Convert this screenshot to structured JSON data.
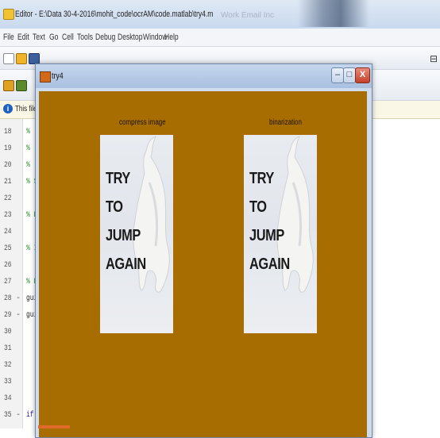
{
  "editor": {
    "title": "Editor - E:\\Data 30-4-2016\\mohit_code\\ocrAM\\code.matlab\\try4.m",
    "ghost_title": "Work Email Inc",
    "menu": [
      "File",
      "Edit",
      "Text",
      "Go",
      "Cell",
      "Tools",
      "Debug",
      "Desktop",
      "Window",
      "Help"
    ],
    "info_text": "This file uses C",
    "lines": [
      {
        "num": "18",
        "dash": "",
        "code": "%",
        "style": "comment"
      },
      {
        "num": "19",
        "dash": "",
        "code": "%",
        "style": "comment"
      },
      {
        "num": "20",
        "dash": "",
        "code": "%",
        "style": "comment"
      },
      {
        "num": "21",
        "dash": "",
        "code": "% S",
        "style": "comment"
      },
      {
        "num": "22",
        "dash": "",
        "code": "",
        "style": "comment"
      },
      {
        "num": "23",
        "dash": "",
        "code": "% E",
        "style": "comment"
      },
      {
        "num": "24",
        "dash": "",
        "code": "",
        "style": "comment"
      },
      {
        "num": "25",
        "dash": "",
        "code": "% I",
        "style": "comment"
      },
      {
        "num": "26",
        "dash": "",
        "code": "",
        "style": "comment"
      },
      {
        "num": "27",
        "dash": "",
        "code": "% E",
        "style": "comment"
      },
      {
        "num": "28",
        "dash": "-",
        "code": "gui",
        "style": "plain"
      },
      {
        "num": "29",
        "dash": "-",
        "code": "gui",
        "style": "plain"
      },
      {
        "num": "30",
        "dash": "",
        "code": "",
        "style": "plain"
      },
      {
        "num": "31",
        "dash": "",
        "code": "",
        "style": "plain"
      },
      {
        "num": "32",
        "dash": "",
        "code": "",
        "style": "plain"
      },
      {
        "num": "33",
        "dash": "",
        "code": "",
        "style": "plain"
      },
      {
        "num": "34",
        "dash": "",
        "code": "",
        "style": "plain"
      },
      {
        "num": "35",
        "dash": "-",
        "code": "if",
        "style": "kw"
      }
    ]
  },
  "figure": {
    "title": "try4",
    "buttons": {
      "minimize": "–",
      "maximize": "□",
      "close": "X"
    },
    "canvas_color": "#a86d00",
    "panels": [
      {
        "label": "compress image",
        "text": [
          "TRY",
          "TO",
          "JUMP",
          "AGAIN"
        ]
      },
      {
        "label": "binarization",
        "text": [
          "TRY",
          "TO",
          "JUMP",
          "AGAIN"
        ]
      }
    ]
  }
}
